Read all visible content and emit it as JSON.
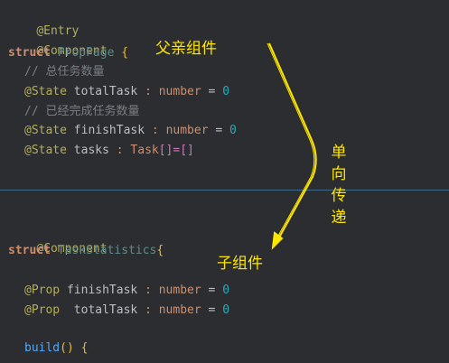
{
  "code": {
    "l1_annotation": "@Entry",
    "l2_annotation": "@Component",
    "l3_kw": "struct",
    "l3_name": "PropPage",
    "l3_brace": "{",
    "l4_comment": "// 总任务数量",
    "l5_annotation": "@State",
    "l5_field": "totalTask",
    "l5_colon": ":",
    "l5_type": "number",
    "l5_eq": "=",
    "l5_val": "0",
    "l6_comment": "// 已经完成任务数量",
    "l7_annotation": "@State",
    "l7_field": "finishTask",
    "l7_colon": ":",
    "l7_type": "number",
    "l7_eq": "=",
    "l7_val": "0",
    "l8_annotation": "@State",
    "l8_field": "tasks",
    "l8_colon": ":",
    "l8_type": "Task",
    "l8_rest": "[]=[]",
    "l9_annotation": "@Component",
    "l10_kw": "struct",
    "l10_name": "TaskStatistics",
    "l10_brace": "{",
    "l11_annotation": "@Prop",
    "l11_field": "finishTask",
    "l11_colon": ":",
    "l11_type": "number",
    "l11_eq": "=",
    "l11_val": "0",
    "l12_annotation": "@Prop",
    "l12_field": " totalTask",
    "l12_colon": ":",
    "l12_type": "number",
    "l12_eq": "=",
    "l12_val": "0",
    "l13_fn": "build",
    "l13_parens": "()",
    "l13_brace": "{"
  },
  "annotations": {
    "parent_label": "父亲组件",
    "child_label": "子组件",
    "one_way_chars": [
      "单",
      "向",
      "传",
      "递"
    ],
    "color": "#ffe600"
  },
  "theme": {
    "background": "#2b2d30",
    "annotation": "#b3ae60",
    "keyword": "#cf8e6d",
    "type": "#5f8c8a",
    "field": "#c77dbb",
    "number": "#2aacb8",
    "comment": "#7a7e85",
    "function": "#56a8f5"
  }
}
